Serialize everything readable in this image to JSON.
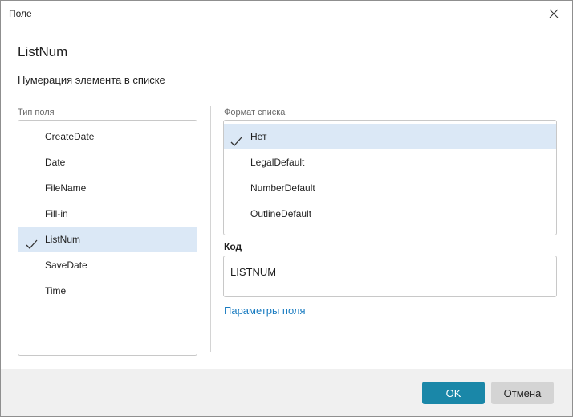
{
  "window": {
    "title": "Поле"
  },
  "heading": "ListNum",
  "subheading": "Нумерация элемента в списке",
  "field_type": {
    "label": "Тип поля",
    "items": [
      {
        "label": "CreateDate",
        "selected": false
      },
      {
        "label": "Date",
        "selected": false
      },
      {
        "label": "FileName",
        "selected": false
      },
      {
        "label": "Fill-in",
        "selected": false
      },
      {
        "label": "ListNum",
        "selected": true
      },
      {
        "label": "SaveDate",
        "selected": false
      },
      {
        "label": "Time",
        "selected": false
      }
    ]
  },
  "list_format": {
    "label": "Формат списка",
    "items": [
      {
        "label": "Нет",
        "selected": true
      },
      {
        "label": "LegalDefault",
        "selected": false
      },
      {
        "label": "NumberDefault",
        "selected": false
      },
      {
        "label": "OutlineDefault",
        "selected": false
      }
    ]
  },
  "code": {
    "label": "Код",
    "value": "LISTNUM"
  },
  "field_params_link": "Параметры поля",
  "buttons": {
    "ok": "OK",
    "cancel": "Отмена"
  },
  "colors": {
    "accent": "#1a87a8",
    "selection": "#dbe8f6",
    "link": "#1a7cc1"
  },
  "icons": {
    "close": "close-icon",
    "check": "checkmark-icon"
  }
}
